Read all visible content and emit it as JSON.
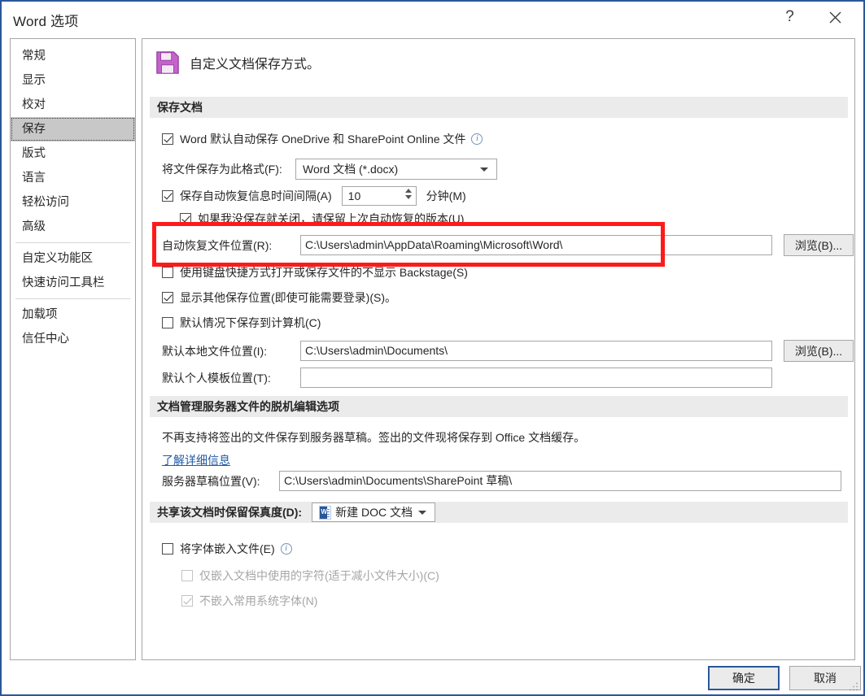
{
  "window": {
    "title": "Word 选项",
    "help_label": "?",
    "close_label": "✕"
  },
  "sidebar": {
    "items": [
      {
        "label": "常规",
        "selected": false
      },
      {
        "label": "显示",
        "selected": false
      },
      {
        "label": "校对",
        "selected": false
      },
      {
        "label": "保存",
        "selected": true
      },
      {
        "label": "版式",
        "selected": false
      },
      {
        "label": "语言",
        "selected": false
      },
      {
        "label": "轻松访问",
        "selected": false
      },
      {
        "label": "高级",
        "selected": false
      },
      {
        "label": "自定义功能区",
        "selected": false
      },
      {
        "label": "快速访问工具栏",
        "selected": false
      },
      {
        "label": "加载项",
        "selected": false
      },
      {
        "label": "信任中心",
        "selected": false
      }
    ]
  },
  "content": {
    "header": "自定义文档保存方式。",
    "header_icon": "floppy-disk-icon",
    "sections": {
      "save_documents": {
        "title": "保存文档",
        "autosave_checkbox": "Word 默认自动保存 OneDrive 和 SharePoint Online 文件",
        "format_label": "将文件保存为此格式(F):",
        "format_value": "Word 文档 (*.docx)",
        "autorecover_checkbox": "保存自动恢复信息时间间隔(A)",
        "autorecover_minutes": "10",
        "minutes_label": "分钟(M)",
        "keep_last_checkbox": "如果我没保存就关闭，请保留上次自动恢复的版本(U)",
        "autorecover_loc_label": "自动恢复文件位置(R):",
        "autorecover_loc_value": "C:\\Users\\admin\\AppData\\Roaming\\Microsoft\\Word\\",
        "autorecover_browse": "浏览(B)...",
        "backstage_checkbox": "使用键盘快捷方式打开或保存文件的不显示 Backstage(S)",
        "other_locations_checkbox": "显示其他保存位置(即使可能需要登录)(S)。",
        "save_to_computer_checkbox": "默认情况下保存到计算机(C)",
        "local_loc_label": "默认本地文件位置(I):",
        "local_loc_value": "C:\\Users\\admin\\Documents\\",
        "local_browse": "浏览(B)...",
        "template_loc_label": "默认个人模板位置(T):",
        "template_loc_value": ""
      },
      "offline_editing": {
        "title": "文档管理服务器文件的脱机编辑选项",
        "description": "不再支持将签出的文件保存到服务器草稿。签出的文件现将保存到 Office 文档缓存。",
        "link": "了解详细信息",
        "server_draft_label": "服务器草稿位置(V):",
        "server_draft_value": "C:\\Users\\admin\\Documents\\SharePoint 草稿\\"
      },
      "fidelity": {
        "title": "共享该文档时保留保真度(D):",
        "doc_value": "新建 DOC 文档",
        "embed_fonts_checkbox": "将字体嵌入文件(E)",
        "embed_used_only_checkbox": "仅嵌入文档中使用的字符(适于减小文件大小)(C)",
        "no_embed_common_checkbox": "不嵌入常用系统字体(N)"
      }
    }
  },
  "footer": {
    "ok_label": "确定",
    "cancel_label": "取消"
  },
  "annotation": {
    "highlight_color": "#ff1a1a"
  }
}
